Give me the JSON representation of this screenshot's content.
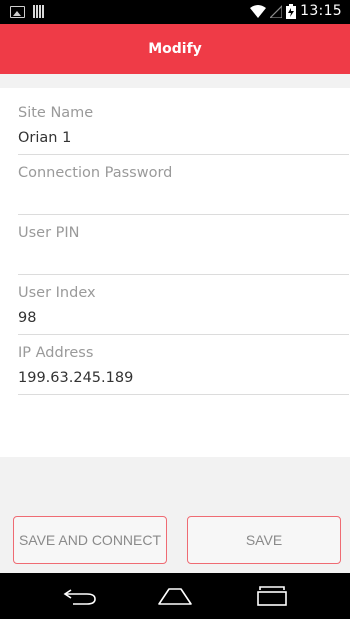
{
  "status_bar": {
    "time": "13:15",
    "icons": [
      "image-notification-icon",
      "barcode-notification-icon",
      "wifi-icon",
      "signal-icon",
      "battery-icon"
    ]
  },
  "header": {
    "title": "Modify",
    "color": "#ef3b47"
  },
  "form": {
    "site_name": {
      "label": "Site Name",
      "value": "Orian 1"
    },
    "connection_password": {
      "label": "Connection Password",
      "value": ""
    },
    "user_pin": {
      "label": "User PIN",
      "value": ""
    },
    "user_index": {
      "label": "User Index",
      "value": "98"
    },
    "ip_address": {
      "label": "IP Address",
      "value": "199.63.245.189"
    }
  },
  "buttons": {
    "save_and_connect": "SAVE AND CONNECT",
    "save": "SAVE"
  },
  "nav_bar": {
    "icons": [
      "back-icon",
      "home-icon",
      "recent-apps-icon"
    ]
  }
}
